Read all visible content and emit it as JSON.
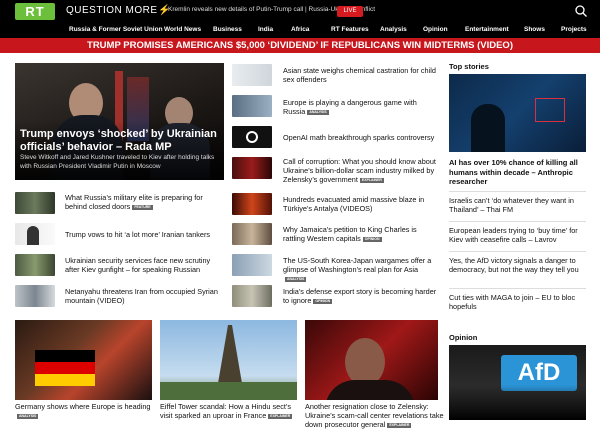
{
  "header": {
    "logo": "RT",
    "tagline": "QUESTION MORE",
    "ticker": "Kremlin reveals new details of Putin-Trump call | Russia-Ukraine conflict",
    "live_label": "LIVE"
  },
  "nav": [
    "Russia & Former Soviet Union",
    "World News",
    "Business",
    "India",
    "Africa",
    "RT Features",
    "Analysis",
    "Opinion",
    "Entertainment",
    "Shows",
    "Projects"
  ],
  "banner": "TRUMP PROMISES AMERICANS $5,000 ‘DIVIDEND’ IF REPUBLICANS WIN MIDTERMS (VIDEO)",
  "hero": {
    "title": "Trump envoys ‘shocked’ by Ukrainian officials’ behavior – Rada MP",
    "subtitle": "Steve Witkoff and Jared Kushner traveled to Kiev after holding talks with Russian President Vladimir Putin in Moscow"
  },
  "left_list": [
    {
      "title": "What Russia’s military elite is preparing for behind closed doors",
      "badge": "FEATURE"
    },
    {
      "title": "Trump vows to hit ‘a lot more’ Iranian tankers",
      "badge": ""
    },
    {
      "title": "Ukrainian security services face new scrutiny after Kiev gunfight – for speaking Russian",
      "badge": ""
    },
    {
      "title": "Netanyahu threatens Iran from occupied Syrian mountain (VIDEO)",
      "badge": ""
    }
  ],
  "mid_list": [
    {
      "title": "Asian state weighs chemical castration for child sex offenders",
      "badge": ""
    },
    {
      "title": "Europe is playing a dangerous game with Russia",
      "badge": "ANALYSIS"
    },
    {
      "title": "OpenAI math breakthrough sparks controversy",
      "badge": ""
    },
    {
      "title": "Call of corruption: What you should know about Ukraine’s billion-dollar scam industry milked by Zelensky’s government",
      "badge": "EXPLAINER"
    },
    {
      "title": "Hundreds evacuated amid massive blaze in Türkiye’s Antalya (VIDEOS)",
      "badge": ""
    },
    {
      "title": "Why Jamaica’s petition to King Charles is rattling Western capitals",
      "badge": "OPINION"
    },
    {
      "title": "The US-South Korea-Japan wargames offer a glimpse of Washington’s real plan for Asia",
      "badge": "ANALYSIS"
    },
    {
      "title": "India’s defense export story is becoming harder to ignore",
      "badge": "OPINION"
    }
  ],
  "top_stories": {
    "heading": "Top stories",
    "lead": "AI has over 10% chance of killing all humans within decade – Anthropic researcher",
    "items": [
      "Israelis can’t ‘do whatever they want in Thailand’ – Thai FM",
      "European leaders trying to ‘buy time’ for Kiev with ceasefire calls – Lavrov",
      "Yes, the AfD victory signals a danger to democracy, but not the way they tell you",
      "Cut ties with MAGA to join – EU to bloc hopefuls"
    ]
  },
  "opinion": {
    "heading": "Opinion",
    "image_text": "AfD"
  },
  "bottom": [
    {
      "title": "Germany shows where Europe is heading",
      "badge": "ANALYSIS"
    },
    {
      "title": "Eiffel Tower scandal: How a Hindu sect’s visit sparked an uproar in France",
      "badge": "EXPLAINER"
    },
    {
      "title": "Another resignation close to Zelensky: Ukraine’s scam-call center revelations take down prosecutor general",
      "badge": "EXPLAINER"
    }
  ],
  "colors": {
    "brand_red": "#c8161d",
    "logo_green": "#6bbf3a"
  }
}
